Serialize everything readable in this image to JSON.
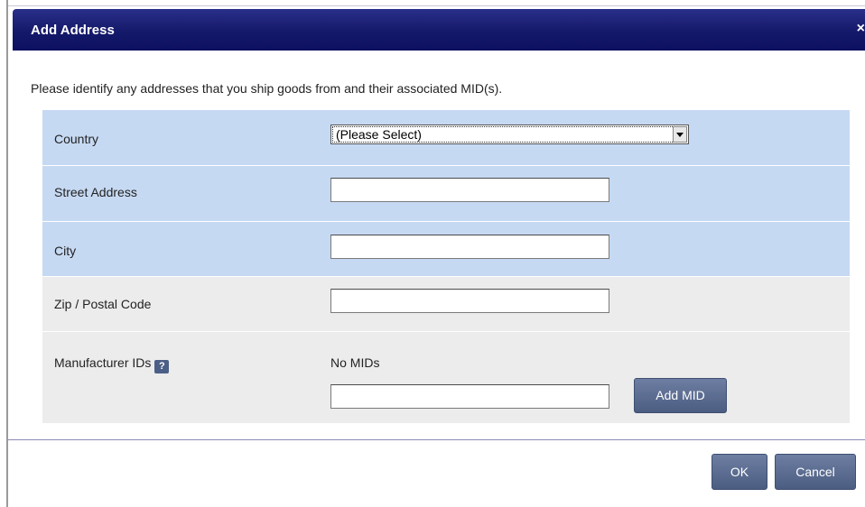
{
  "dialog": {
    "title": "Add Address",
    "close_glyph": "×",
    "intro": "Please identify any addresses that you ship goods from and their associated MID(s)."
  },
  "form": {
    "country": {
      "label": "Country",
      "selected": "(Please Select)"
    },
    "street": {
      "label": "Street Address",
      "value": ""
    },
    "city": {
      "label": "City",
      "value": ""
    },
    "zip": {
      "label": "Zip / Postal Code",
      "value": ""
    },
    "mids": {
      "label": "Manufacturer IDs",
      "help_glyph": "?",
      "status": "No MIDs",
      "value": "",
      "add_label": "Add MID"
    }
  },
  "footer": {
    "ok_label": "OK",
    "cancel_label": "Cancel"
  },
  "colors": {
    "titlebar": "#15196a",
    "row_blue": "#c6d9f3",
    "row_grey": "#ececec",
    "button": "#55668a"
  },
  "icons": {
    "close": "close-icon",
    "help": "question-mark-icon",
    "dropdown": "chevron-down-icon"
  }
}
